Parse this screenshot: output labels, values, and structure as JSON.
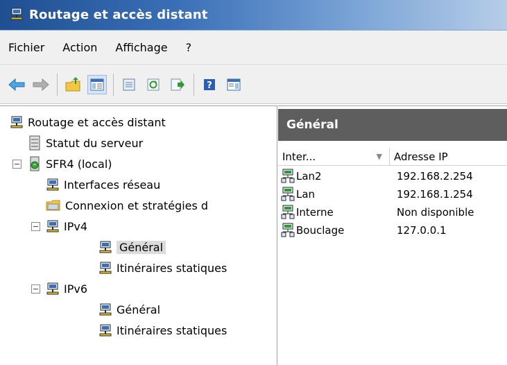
{
  "window": {
    "title": "Routage et accès distant"
  },
  "menu": [
    "Fichier",
    "Action",
    "Affichage",
    "?"
  ],
  "toolbar": {
    "buttons": [
      "back-arrow-icon",
      "forward-arrow-icon",
      "up-folder-icon",
      "show-hide-tree-icon",
      "properties-icon",
      "refresh-icon",
      "export-list-icon",
      "help-icon",
      "show-hide-action-pane-icon"
    ]
  },
  "tree": {
    "root": "Routage et accès distant",
    "server_status": "Statut du serveur",
    "server": "SFR4 (local)",
    "interfaces": "Interfaces réseau",
    "connections": "Connexion et stratégies d",
    "ipv4": "IPv4",
    "ipv4_general": "Général",
    "ipv4_static": "Itinéraires statiques",
    "ipv6": "IPv6",
    "ipv6_general": "Général",
    "ipv6_static": "Itinéraires statiques",
    "expander_minus": "⊟"
  },
  "right_pane": {
    "header": "Général",
    "columns": [
      "Inter...",
      "Adresse IP"
    ],
    "sort_indicator": "▼",
    "rows": [
      {
        "name": "Lan2",
        "ip": "192.168.2.254"
      },
      {
        "name": "Lan",
        "ip": "192.168.1.254"
      },
      {
        "name": "Interne",
        "ip": "Non disponible"
      },
      {
        "name": "Bouclage",
        "ip": "127.0.0.1"
      }
    ]
  }
}
